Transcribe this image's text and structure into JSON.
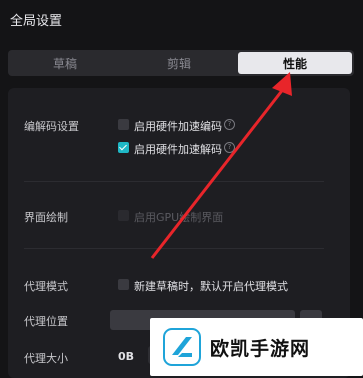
{
  "window": {
    "title": "全局设置"
  },
  "tabs": [
    {
      "label": "草稿",
      "active": false
    },
    {
      "label": "剪辑",
      "active": false
    },
    {
      "label": "性能",
      "active": true
    }
  ],
  "codec": {
    "label": "编解码设置",
    "hw_encode": {
      "label": "启用硬件加速编码",
      "checked": false
    },
    "hw_decode": {
      "label": "启用硬件加速解码",
      "checked": true
    }
  },
  "render": {
    "label": "界面绘制",
    "gpu": {
      "label": "启用GPU绘制界面",
      "checked": false,
      "disabled": true
    }
  },
  "proxy": {
    "mode_label": "代理模式",
    "mode_option": {
      "label": "新建草稿时，默认开启代理模式",
      "checked": false
    },
    "location_label": "代理位置",
    "size_label": "代理大小",
    "size_value": "0B"
  },
  "watermark": {
    "text": "欧凯手游网"
  },
  "colors": {
    "accent": "#1fb8c6",
    "annotation": "#e8252a"
  },
  "icons": {
    "help": "question-circle-icon",
    "delete": "trash-icon",
    "folder": "folder-icon"
  }
}
